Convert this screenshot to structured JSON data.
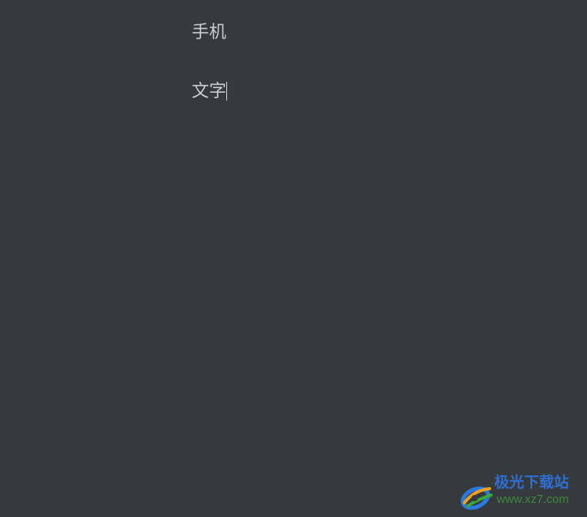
{
  "editor": {
    "lines": [
      {
        "text": "手机"
      },
      {
        "text": "文字"
      }
    ],
    "caret_line": 2
  },
  "watermark": {
    "title": "极光下载站",
    "url": "www.xz7.com"
  },
  "colors": {
    "background": "#363a3e",
    "text": "#c9cdd2",
    "watermark_title": "#2e6fd0",
    "watermark_url": "#3a8a3a"
  }
}
